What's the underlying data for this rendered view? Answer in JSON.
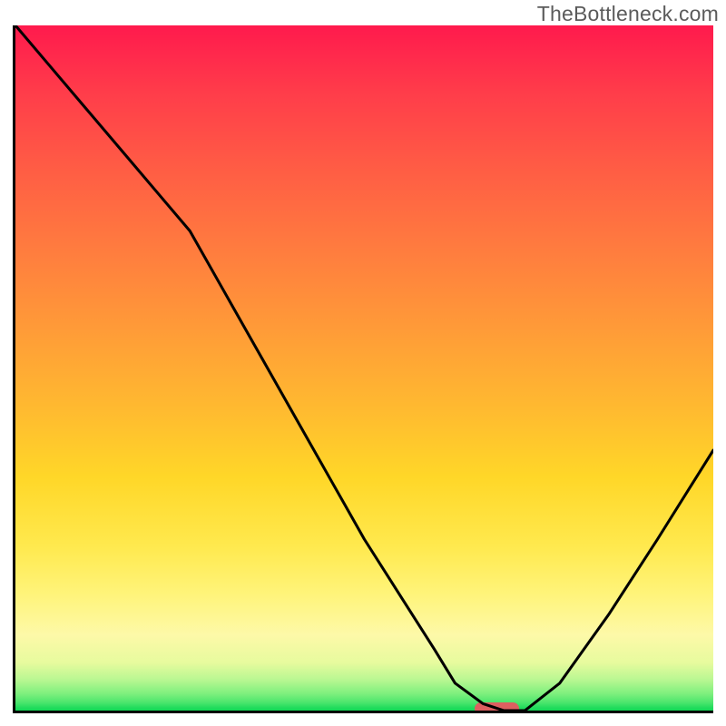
{
  "watermark": "TheBottleneck.com",
  "chart_data": {
    "type": "line",
    "title": "",
    "xlabel": "",
    "ylabel": "",
    "xlim": [
      0,
      100
    ],
    "ylim": [
      0,
      100
    ],
    "notes": "Background vertical gradient from red (top, high bottleneck) through orange/yellow to green (bottom, ideal). The black curve descends from top-left into a minimum near x≈70 then rises toward the right edge. A small rounded red marker sits at the trough on the bottom axis.",
    "series": [
      {
        "name": "bottleneck-curve",
        "x": [
          0,
          5,
          10,
          15,
          20,
          25,
          30,
          35,
          40,
          45,
          50,
          55,
          60,
          63,
          67,
          70,
          73,
          78,
          85,
          92,
          100
        ],
        "values": [
          100,
          94,
          88,
          82,
          76,
          70,
          61,
          52,
          43,
          34,
          25,
          17,
          9,
          4,
          1,
          0,
          0,
          4,
          14,
          25,
          38
        ]
      }
    ],
    "marker": {
      "x_percent": 69,
      "width_percent": 6.3
    },
    "gradient_stops": [
      {
        "pos": 0,
        "color": "#ff1a4d"
      },
      {
        "pos": 10,
        "color": "#ff3d4a"
      },
      {
        "pos": 20,
        "color": "#ff5a45"
      },
      {
        "pos": 32,
        "color": "#ff7a3f"
      },
      {
        "pos": 44,
        "color": "#ff9a38"
      },
      {
        "pos": 56,
        "color": "#ffba30"
      },
      {
        "pos": 66,
        "color": "#ffd728"
      },
      {
        "pos": 76,
        "color": "#ffe94e"
      },
      {
        "pos": 83,
        "color": "#fff47a"
      },
      {
        "pos": 89,
        "color": "#fdf9a8"
      },
      {
        "pos": 93,
        "color": "#e7fb9e"
      },
      {
        "pos": 95.5,
        "color": "#b9f792"
      },
      {
        "pos": 97.5,
        "color": "#7ff07e"
      },
      {
        "pos": 98.8,
        "color": "#4de66d"
      },
      {
        "pos": 99.5,
        "color": "#26dd5e"
      },
      {
        "pos": 100,
        "color": "#12d856"
      }
    ]
  }
}
